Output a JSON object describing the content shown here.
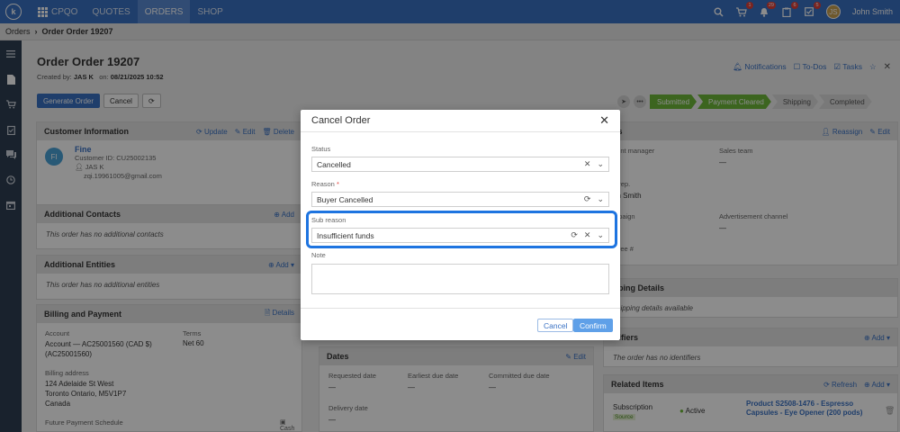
{
  "topbar": {
    "logo": "k",
    "nav": [
      {
        "label": "CPQO",
        "active": false
      },
      {
        "label": "QUOTES",
        "active": false
      },
      {
        "label": "ORDERS",
        "active": true
      },
      {
        "label": "SHOP",
        "active": false
      }
    ],
    "badges": {
      "cart": "1",
      "bell": "29",
      "clipboard": "6",
      "check": "5"
    },
    "avatar": "JS",
    "user_name": "John Smith"
  },
  "breadcrumb": {
    "root": "Orders",
    "current": "Order Order 19207"
  },
  "page": {
    "title": "Order Order 19207",
    "created_by_label": "Created by:",
    "created_by": "JAS K",
    "on_label": "on:",
    "created_on": "08/21/2025 10:52",
    "buttons": {
      "generate": "Generate Order",
      "cancel": "Cancel"
    },
    "header_links": {
      "notifications": "Notifications",
      "todos": "To-Dos",
      "tasks": "Tasks"
    },
    "status_steps": [
      "Submitted",
      "Payment Cleared",
      "Shipping",
      "Completed"
    ]
  },
  "customer": {
    "header": "Customer Information",
    "update": "Update",
    "edit": "Edit",
    "delete": "Delete",
    "initials": "FI",
    "name": "Fine",
    "customer_id": "Customer ID: CU25002135",
    "contact": "JAS K",
    "email": "zqi.19961005@gmail.com"
  },
  "additional_contacts": {
    "header": "Additional Contacts",
    "add": "Add",
    "empty": "This order has no additional contacts"
  },
  "additional_entities": {
    "header": "Additional Entities",
    "add": "Add",
    "empty": "This order has no additional entities"
  },
  "billing": {
    "header": "Billing and Payment",
    "details": "Details",
    "account_label": "Account",
    "account_value": "Account — AC25001560 (CAD $) (AC25001560)",
    "terms_label": "Terms",
    "terms_value": "Net 60",
    "address_label": "Billing address",
    "address_line1": "124 Adelaide St West",
    "address_line2": "Toronto Ontario, M5V1P7",
    "address_line3": "Canada",
    "schedule_label": "Future Payment Schedule",
    "cash": "Cash"
  },
  "sales": {
    "header_fragment": "les",
    "reassign": "Reassign",
    "edit": "Edit",
    "account_manager": "ount manager",
    "sales_team": "Sales team",
    "dash": "—",
    "rep": "e rep.",
    "rep_name": "an Smith",
    "campaign": "mpaign",
    "adv_channel": "Advertisement channel",
    "toll_free": "l free #"
  },
  "shipping": {
    "header": "ipping Details",
    "empty": "shipping details available"
  },
  "identifiers": {
    "header": "ntifiers",
    "add": "Add",
    "empty": "The order has no identifiers"
  },
  "dates": {
    "header": "Dates",
    "edit": "Edit",
    "requested": "Requested date",
    "earliest": "Earliest due date",
    "committed": "Committed due date",
    "delivery": "Delivery date",
    "dash": "—"
  },
  "related": {
    "header": "Related Items",
    "refresh": "Refresh",
    "add": "Add",
    "subscription": "Subscription",
    "source": "Source",
    "status": "Active",
    "product": "Product S2508-1476 - Espresso Capsules - Eye Opener (200 pods)"
  },
  "modal": {
    "title": "Cancel Order",
    "status_label": "Status",
    "status_value": "Cancelled",
    "reason_label": "Reason",
    "reason_required": "*",
    "reason_value": "Buyer Cancelled",
    "subreason_label": "Sub reason",
    "subreason_value": "Insufficient funds",
    "note_label": "Note",
    "cancel": "Cancel",
    "confirm": "Confirm"
  },
  "colors": {
    "primary": "#3a72c4",
    "success": "#6db83a",
    "highlight": "#1e74e0",
    "sidebar": "#2e3f52"
  }
}
